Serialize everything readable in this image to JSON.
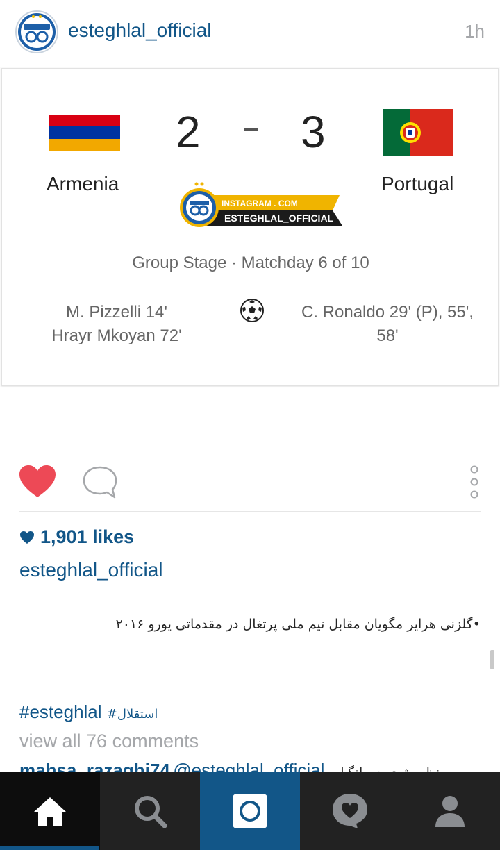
{
  "header": {
    "username": "esteghlal_official",
    "time": "1h"
  },
  "match": {
    "home_team": "Armenia",
    "away_team": "Portugal",
    "home_score": "2",
    "away_score": "3",
    "stage": "Group Stage · Matchday 6 of 10",
    "home_scorers": [
      "M. Pizzelli 14'",
      "Hrayr Mkoyan 72'"
    ],
    "away_scorers": "C. Ronaldo 29' (P), 55', 58'",
    "watermark_line1": "INSTAGRAM . COM",
    "watermark_line2": "ESTEGHLAL_OFFICIAL"
  },
  "actions": {
    "like_icon": "heart-icon",
    "comment_icon": "comment-bubble-icon",
    "more_icon": "more-vertical-icon",
    "liked_color": "#ed4956"
  },
  "likes": {
    "text": "1,901 likes"
  },
  "caption": {
    "username": "esteghlal_official",
    "text": "•گلزنی هرایر مگویان مقابل تیم ملی پرتغال در مقدماتی یورو ۲۰۱۶"
  },
  "hashtags": {
    "tag1": "#esteghlal",
    "tag2": "#استقلال"
  },
  "comments": {
    "view_all": "view all 76 comments",
    "first_user": "mahsa_razaghi74",
    "first_mention": "@esteghlal_official",
    "first_text": "نظر مثبت جیو لنگیار و"
  },
  "nav": {
    "items": [
      "home-icon",
      "search-icon",
      "camera-icon",
      "activity-heart-icon",
      "profile-icon"
    ],
    "active": "home",
    "accent": "#125688",
    "bar_color": "#222222"
  }
}
